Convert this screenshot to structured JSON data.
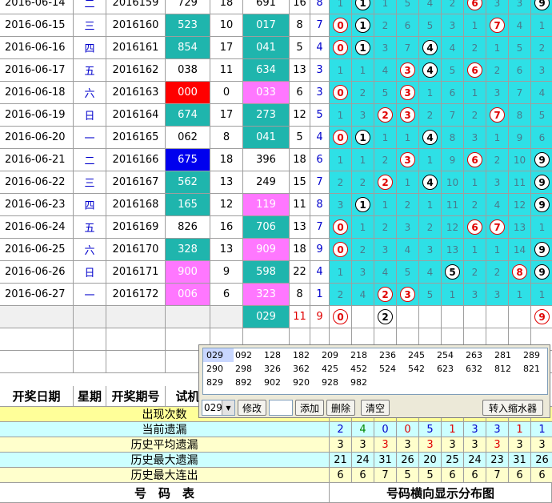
{
  "rows": [
    {
      "date": "2016-06-14",
      "week": "二",
      "issue": "2016159",
      "draw": "729",
      "draw_bg": "#ffffff",
      "draw_color": "#000000",
      "sum": "18",
      "trial": "691",
      "trial_bg": "#ffffff",
      "span": "16",
      "tail": "8",
      "dist": [
        "1",
        "①",
        "1",
        "5",
        "4",
        "2",
        "⑥",
        "3",
        "3",
        "⑨"
      ]
    },
    {
      "date": "2016-06-15",
      "week": "三",
      "issue": "2016160",
      "draw": "523",
      "draw_bg": "#1fb5ad",
      "draw_color": "#ffffff",
      "sum": "10",
      "trial": "017",
      "trial_bg": "#1fb5ad",
      "span": "8",
      "tail": "7",
      "dist": [
        "⓪",
        "①",
        "2",
        "6",
        "5",
        "3",
        "1",
        "⑦",
        "4",
        "1"
      ]
    },
    {
      "date": "2016-06-16",
      "week": "四",
      "issue": "2016161",
      "draw": "854",
      "draw_bg": "#1fb5ad",
      "draw_color": "#ffffff",
      "sum": "17",
      "trial": "041",
      "trial_bg": "#1fb5ad",
      "span": "5",
      "tail": "4",
      "dist": [
        "⓪",
        "①",
        "3",
        "7",
        "④",
        "4",
        "2",
        "1",
        "5",
        "2"
      ]
    },
    {
      "date": "2016-06-17",
      "week": "五",
      "issue": "2016162",
      "draw": "038",
      "draw_bg": "#ffffff",
      "draw_color": "#000000",
      "sum": "11",
      "trial": "634",
      "trial_bg": "#1fb5ad",
      "span": "13",
      "tail": "3",
      "dist": [
        "1",
        "1",
        "4",
        "③",
        "④",
        "5",
        "⑥",
        "2",
        "6",
        "3"
      ]
    },
    {
      "date": "2016-06-18",
      "week": "六",
      "issue": "2016163",
      "draw": "000",
      "draw_bg": "#ff0000",
      "draw_color": "#ffffff",
      "sum": "0",
      "trial": "033",
      "trial_bg": "#ff77ff",
      "span": "6",
      "tail": "3",
      "dist": [
        "⓪",
        "2",
        "5",
        "③",
        "1",
        "6",
        "1",
        "3",
        "7",
        "4"
      ]
    },
    {
      "date": "2016-06-19",
      "week": "日",
      "issue": "2016164",
      "draw": "674",
      "draw_bg": "#1fb5ad",
      "draw_color": "#ffffff",
      "sum": "17",
      "trial": "273",
      "trial_bg": "#1fb5ad",
      "span": "12",
      "tail": "5",
      "dist": [
        "1",
        "3",
        "②",
        "③",
        "2",
        "7",
        "2",
        "⑦",
        "8",
        "5"
      ]
    },
    {
      "date": "2016-06-20",
      "week": "一",
      "issue": "2016165",
      "draw": "062",
      "draw_bg": "#ffffff",
      "draw_color": "#000000",
      "sum": "8",
      "trial": "041",
      "trial_bg": "#1fb5ad",
      "span": "5",
      "tail": "4",
      "dist": [
        "⓪",
        "①",
        "1",
        "1",
        "④",
        "8",
        "3",
        "1",
        "9",
        "6"
      ]
    },
    {
      "date": "2016-06-21",
      "week": "二",
      "issue": "2016166",
      "draw": "675",
      "draw_bg": "#0000ee",
      "draw_color": "#ffffff",
      "sum": "18",
      "trial": "396",
      "trial_bg": "#ffffff",
      "span": "18",
      "tail": "6",
      "dist": [
        "1",
        "1",
        "2",
        "③",
        "1",
        "9",
        "⑥",
        "2",
        "10",
        "⑨"
      ]
    },
    {
      "date": "2016-06-22",
      "week": "三",
      "issue": "2016167",
      "draw": "562",
      "draw_bg": "#1fb5ad",
      "draw_color": "#ffffff",
      "sum": "13",
      "trial": "249",
      "trial_bg": "#ffffff",
      "span": "15",
      "tail": "7",
      "dist": [
        "2",
        "2",
        "②",
        "1",
        "④",
        "10",
        "1",
        "3",
        "11",
        "⑨"
      ]
    },
    {
      "date": "2016-06-23",
      "week": "四",
      "issue": "2016168",
      "draw": "165",
      "draw_bg": "#1fb5ad",
      "draw_color": "#ffffff",
      "sum": "12",
      "trial": "119",
      "trial_bg": "#ff77ff",
      "span": "11",
      "tail": "8",
      "dist": [
        "3",
        "①",
        "1",
        "2",
        "1",
        "11",
        "2",
        "4",
        "12",
        "⑨"
      ]
    },
    {
      "date": "2016-06-24",
      "week": "五",
      "issue": "2016169",
      "draw": "826",
      "draw_bg": "#ffffff",
      "draw_color": "#000000",
      "sum": "16",
      "trial": "706",
      "trial_bg": "#1fb5ad",
      "span": "13",
      "tail": "7",
      "dist": [
        "⓪",
        "1",
        "2",
        "3",
        "2",
        "12",
        "⑥",
        "⑦",
        "13",
        "1"
      ]
    },
    {
      "date": "2016-06-25",
      "week": "六",
      "issue": "2016170",
      "draw": "328",
      "draw_bg": "#1fb5ad",
      "draw_color": "#ffffff",
      "sum": "13",
      "trial": "909",
      "trial_bg": "#ff77ff",
      "span": "18",
      "tail": "9",
      "dist": [
        "⓪",
        "2",
        "3",
        "4",
        "3",
        "13",
        "1",
        "1",
        "14",
        "⑨"
      ]
    },
    {
      "date": "2016-06-26",
      "week": "日",
      "issue": "2016171",
      "draw": "900",
      "draw_bg": "#ff77ff",
      "draw_color": "#ffffff",
      "sum": "9",
      "trial": "598",
      "trial_bg": "#1fb5ad",
      "span": "22",
      "tail": "4",
      "dist": [
        "1",
        "3",
        "4",
        "5",
        "4",
        "⑤",
        "2",
        "2",
        "⑧",
        "⑨"
      ]
    },
    {
      "date": "2016-06-27",
      "week": "一",
      "issue": "2016172",
      "draw": "006",
      "draw_bg": "#ff77ff",
      "draw_color": "#ffffff",
      "sum": "6",
      "trial": "323",
      "trial_bg": "#ff77ff",
      "span": "8",
      "tail": "1",
      "dist": [
        "2",
        "4",
        "②",
        "③",
        "5",
        "1",
        "3",
        "3",
        "1",
        "1"
      ]
    }
  ],
  "forecast": {
    "trial": "029",
    "span": "11",
    "tail": "9",
    "dist": [
      "⓪",
      "",
      "②",
      "",
      "",
      "",
      "",
      "",
      "",
      "⑨"
    ]
  },
  "header": {
    "date": "开奖日期",
    "week": "星期",
    "issue": "开奖期号",
    "draw": "试机"
  },
  "stats": [
    {
      "label": "出现次数",
      "values": [
        "",
        "",
        "",
        "",
        "",
        "",
        "",
        "",
        "",
        ""
      ]
    },
    {
      "label": "当前遗漏",
      "values": [
        "2",
        "4",
        "0",
        "0",
        "5",
        "1",
        "3",
        "3",
        "1",
        "1"
      ]
    },
    {
      "label": "历史平均遗漏",
      "values": [
        "3",
        "3",
        "3",
        "3",
        "3",
        "3",
        "3",
        "3",
        "3",
        "3"
      ]
    },
    {
      "label": "历史最大遗漏",
      "values": [
        "21",
        "24",
        "31",
        "26",
        "20",
        "25",
        "24",
        "23",
        "31",
        "26"
      ]
    },
    {
      "label": "历史最大连出",
      "values": [
        "6",
        "6",
        "7",
        "5",
        "5",
        "6",
        "6",
        "7",
        "6",
        "6"
      ]
    }
  ],
  "footer": {
    "left": "号　码　表",
    "right": "号码横向显示分布图"
  },
  "popup": {
    "items": [
      "029",
      "092",
      "128",
      "182",
      "209",
      "218",
      "236",
      "245",
      "254",
      "263",
      "281",
      "289",
      "290",
      "298",
      "326",
      "362",
      "425",
      "452",
      "524",
      "542",
      "623",
      "632",
      "812",
      "821",
      "829",
      "892",
      "902",
      "920",
      "928",
      "982"
    ],
    "selected": "029",
    "btn_modify": "修改",
    "btn_add": "添加",
    "btn_delete": "删除",
    "btn_clear": "清空",
    "btn_transfer": "转入缩水器"
  },
  "colors": {
    "cyan": "#00e6e6",
    "dist_bg": "#2ee0e6",
    "stat_yellow": "#ffffcc",
    "stat_cyan": "#ccffff",
    "header_yellow": "#ffff99",
    "red_num": "#e00000",
    "blue_num": "#0000cc",
    "green_num": "#008800"
  }
}
